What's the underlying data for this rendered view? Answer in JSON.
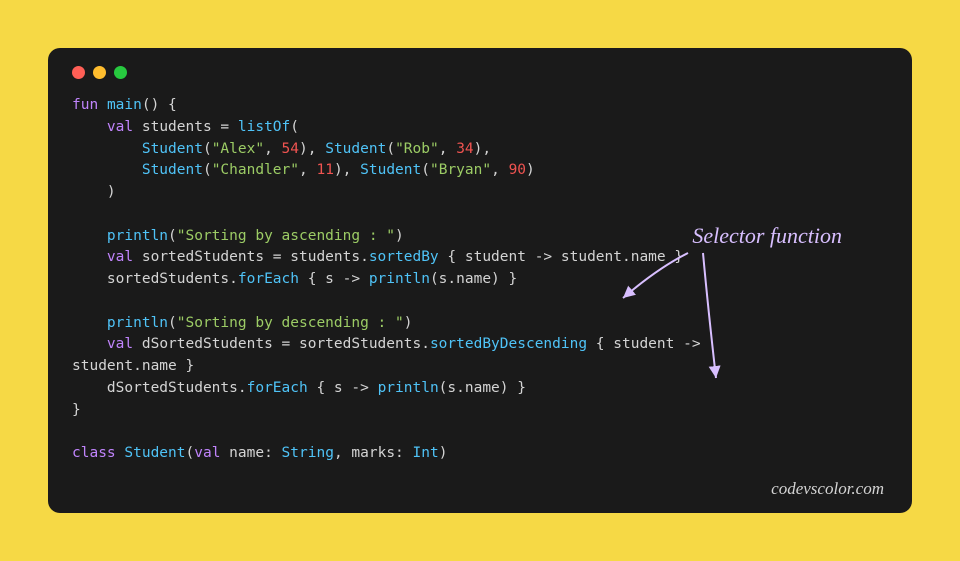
{
  "window": {
    "controls": [
      "red",
      "yellow",
      "green"
    ]
  },
  "code": {
    "l1_fun": "fun",
    "l1_main": "main",
    "l1_rest": "() {",
    "l2_val": "val",
    "l2_students": "students = ",
    "l2_listof": "listOf",
    "l2_open": "(",
    "l3_student1": "Student",
    "l3_open1": "(",
    "l3_str1": "\"Alex\"",
    "l3_comma1": ", ",
    "l3_num1": "54",
    "l3_close1": "), ",
    "l3_student2": "Student",
    "l3_open2": "(",
    "l3_str2": "\"Rob\"",
    "l3_comma2": ", ",
    "l3_num2": "34",
    "l3_close2": "),",
    "l4_student1": "Student",
    "l4_open1": "(",
    "l4_str1": "\"Chandler\"",
    "l4_comma1": ", ",
    "l4_num1": "11",
    "l4_close1": "), ",
    "l4_student2": "Student",
    "l4_open2": "(",
    "l4_str2": "\"Bryan\"",
    "l4_comma2": ", ",
    "l4_num2": "90",
    "l4_close2": ")",
    "l5_close": ")",
    "l6_println": "println",
    "l6_open": "(",
    "l6_str": "\"Sorting by ascending : \"",
    "l6_close": ")",
    "l7_val": "val",
    "l7_sorted": " sortedStudents = students.",
    "l7_sortedby": "sortedBy",
    "l7_lambda": " { student -> student.name }",
    "l8_foreach": "sortedStudents.",
    "l8_fe": "forEach",
    "l8_rest": " { s -> ",
    "l8_println": "println",
    "l8_args": "(s.name) }",
    "l9_println": "println",
    "l9_open": "(",
    "l9_str": "\"Sorting by descending : \"",
    "l9_close": ")",
    "l10_val": "val",
    "l10_dsorted": " dSortedStudents = sortedStudents.",
    "l10_desc": "sortedByDescending",
    "l10_lambda": " { student ->",
    "l10b_rest": "student.name }",
    "l11_dforeach": "dSortedStudents.",
    "l11_fe": "forEach",
    "l11_rest": " { s -> ",
    "l11_println": "println",
    "l11_args": "(s.name) }",
    "l12_close": "}",
    "l13_class": "class",
    "l13_name": "Student",
    "l13_open": "(",
    "l13_val": "val",
    "l13_p1": " name: ",
    "l13_t1": "String",
    "l13_c": ", marks: ",
    "l13_t2": "Int",
    "l13_close": ")"
  },
  "annotation": {
    "label": "Selector function"
  },
  "watermark": {
    "text": "codevscolor.com"
  }
}
